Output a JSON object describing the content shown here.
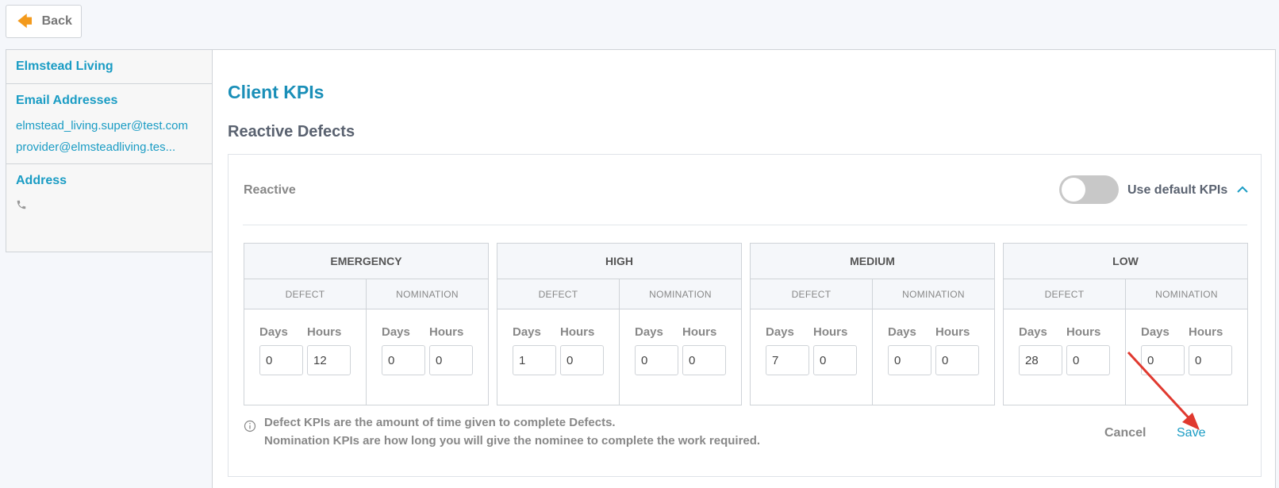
{
  "back_label": "Back",
  "sidebar": {
    "client_name": "Elmstead Living",
    "email_title": "Email Addresses",
    "emails": [
      "elmstead_living.super@test.com",
      "provider@elmsteadliving.tes..."
    ],
    "address_title": "Address"
  },
  "main": {
    "title": "Client KPIs",
    "section_title": "Reactive Defects",
    "panel_label": "Reactive",
    "toggle_label": "Use default KPIs",
    "toggle_on": false,
    "sub_defect": "DEFECT",
    "sub_nomination": "NOMINATION",
    "days_label": "Days",
    "hours_label": "Hours",
    "groups": [
      {
        "name": "EMERGENCY",
        "defect": {
          "days": "0",
          "hours": "12"
        },
        "nomination": {
          "days": "0",
          "hours": "0"
        }
      },
      {
        "name": "HIGH",
        "defect": {
          "days": "1",
          "hours": "0"
        },
        "nomination": {
          "days": "0",
          "hours": "0"
        }
      },
      {
        "name": "MEDIUM",
        "defect": {
          "days": "7",
          "hours": "0"
        },
        "nomination": {
          "days": "0",
          "hours": "0"
        }
      },
      {
        "name": "LOW",
        "defect": {
          "days": "28",
          "hours": "0"
        },
        "nomination": {
          "days": "0",
          "hours": "0"
        }
      }
    ],
    "info_line1": "Defect KPIs are the amount of time given to complete Defects.",
    "info_line2": "Nomination KPIs are how long you will give the nominee to complete the work required.",
    "cancel_label": "Cancel",
    "save_label": "Save"
  },
  "colors": {
    "accent": "#1a9cc4",
    "back_arrow": "#f39a1c",
    "annotation_arrow": "#e0392f"
  },
  "icons": {
    "back": "arrow-left-icon",
    "phone": "phone-icon",
    "chevron": "chevron-up-icon",
    "info": "info-icon"
  }
}
